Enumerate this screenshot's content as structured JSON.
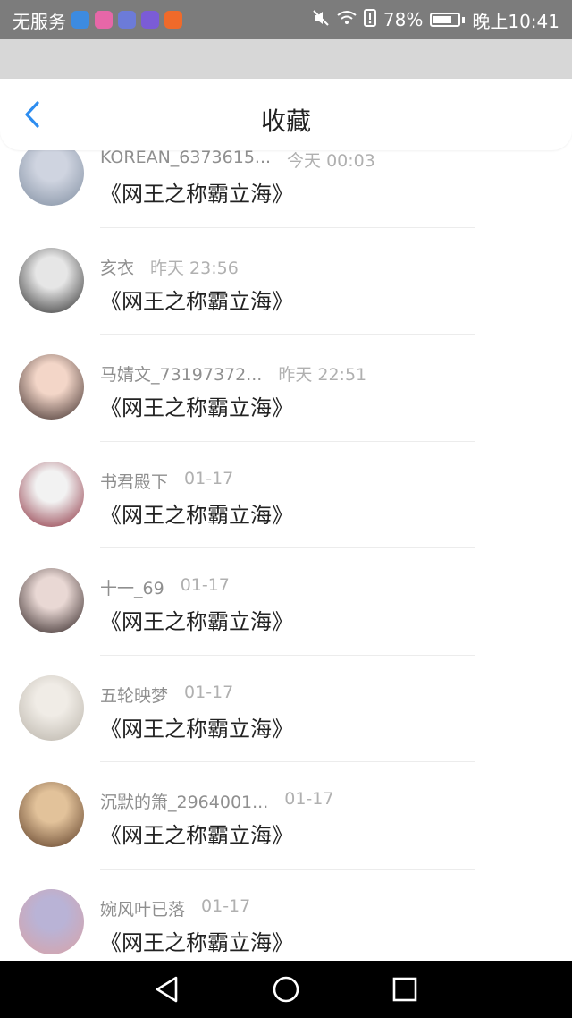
{
  "status_bar": {
    "carrier": "无服务",
    "battery": "78%",
    "time": "晚上10:41",
    "badges": [
      "#3d8be0",
      "#e667a8",
      "#6c7bd8",
      "#7b5cd6",
      "#f06a2a"
    ]
  },
  "header": {
    "title": "收藏",
    "accent": "#2d8df0"
  },
  "favorites": [
    {
      "name": "KOREAN_6373615...",
      "time": "今天 00:03",
      "title": "《网王之称霸立海》",
      "avatar": [
        "#cfd4e0",
        "#7f8da0"
      ]
    },
    {
      "name": "亥衣",
      "time": "昨天 23:56",
      "title": "《网王之称霸立海》",
      "avatar": [
        "#e6e6e6",
        "#2a2a2a"
      ]
    },
    {
      "name": "马婧文_73197372...",
      "time": "昨天 22:51",
      "title": "《网王之称霸立海》",
      "avatar": [
        "#f3d6c8",
        "#3a2a28"
      ]
    },
    {
      "name": "书君殿下",
      "time": "01-17",
      "title": "《网王之称霸立海》",
      "avatar": [
        "#f2f2f2",
        "#8a2b3a"
      ]
    },
    {
      "name": "十一_69",
      "time": "01-17",
      "title": "《网王之称霸立海》",
      "avatar": [
        "#e9d8d4",
        "#2a1e1e"
      ]
    },
    {
      "name": "五轮映梦",
      "time": "01-17",
      "title": "《网王之称霸立海》",
      "avatar": [
        "#f0ece6",
        "#b8b2a8"
      ]
    },
    {
      "name": "沉默的箫_2964001...",
      "time": "01-17",
      "title": "《网王之称霸立海》",
      "avatar": [
        "#e2c29a",
        "#5a3a24"
      ]
    },
    {
      "name": "婉风叶已落",
      "time": "01-17",
      "title": "《网王之称霸立海》",
      "avatar": [
        "#b9b3d6",
        "#d9a2a6"
      ]
    }
  ]
}
